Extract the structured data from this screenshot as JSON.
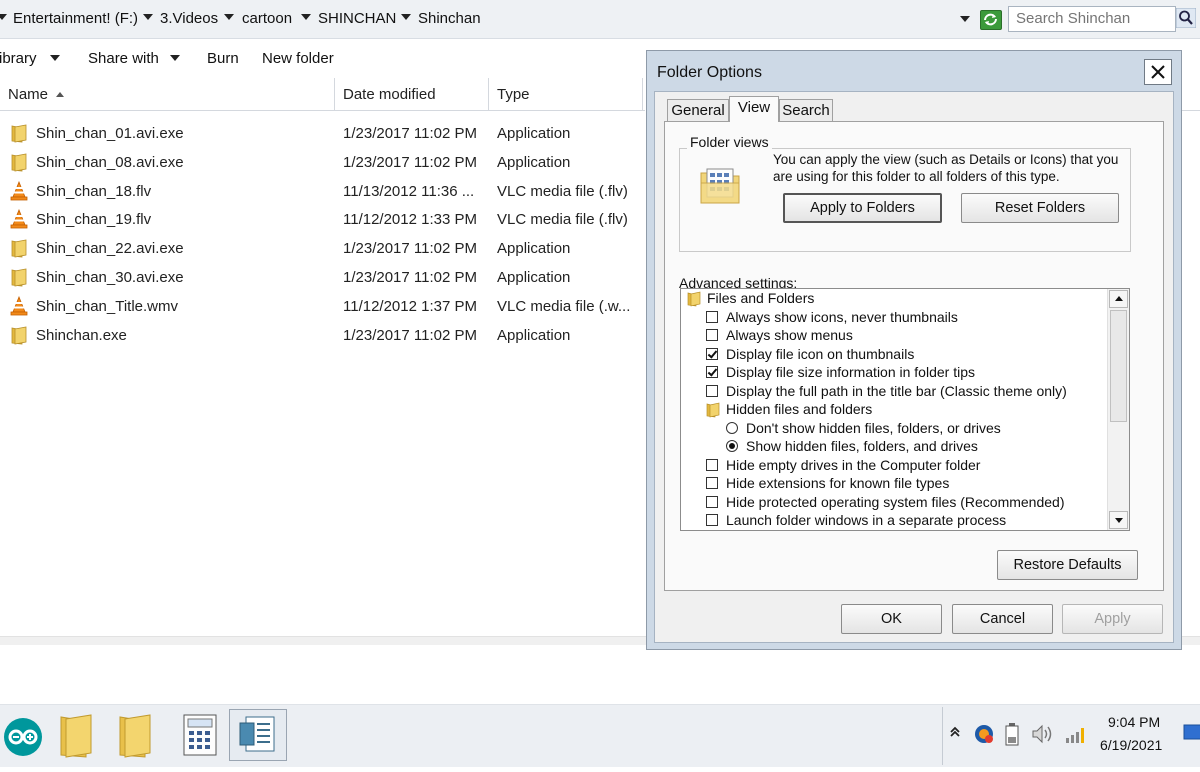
{
  "address_bar": {
    "crumbs": [
      "Entertainment! (F:)",
      "3.Videos",
      "cartoon",
      "SHINCHAN",
      "Shinchan"
    ],
    "search_placeholder": "Search Shinchan"
  },
  "toolbar": {
    "library": "ibrary",
    "share_with": "Share with",
    "burn": "Burn",
    "new_folder": "New folder"
  },
  "file_list": {
    "columns": [
      "Name",
      "Date modified",
      "Type"
    ],
    "rows": [
      {
        "name": "Shin_chan_01.avi.exe",
        "date": "1/23/2017 11:02 PM",
        "type": "Application",
        "icon": "folder-icon"
      },
      {
        "name": "Shin_chan_08.avi.exe",
        "date": "1/23/2017 11:02 PM",
        "type": "Application",
        "icon": "folder-icon"
      },
      {
        "name": "Shin_chan_18.flv",
        "date": "11/13/2012 11:36 ...",
        "type": "VLC media file (.flv)",
        "icon": "vlc-cone-icon"
      },
      {
        "name": "Shin_chan_19.flv",
        "date": "11/12/2012 1:33 PM",
        "type": "VLC media file (.flv)",
        "icon": "vlc-cone-icon"
      },
      {
        "name": "Shin_chan_22.avi.exe",
        "date": "1/23/2017 11:02 PM",
        "type": "Application",
        "icon": "folder-icon"
      },
      {
        "name": "Shin_chan_30.avi.exe",
        "date": "1/23/2017 11:02 PM",
        "type": "Application",
        "icon": "folder-icon"
      },
      {
        "name": "Shin_chan_Title.wmv",
        "date": "11/12/2012 1:37 PM",
        "type": "VLC media file (.w...",
        "icon": "vlc-cone-icon"
      },
      {
        "name": "Shinchan.exe",
        "date": "1/23/2017 11:02 PM",
        "type": "Application",
        "icon": "folder-icon"
      }
    ]
  },
  "dialog": {
    "title": "Folder Options",
    "tabs": [
      "General",
      "View",
      "Search"
    ],
    "active_tab": "View",
    "folder_views_legend": "Folder views",
    "folder_views_text": "You can apply the view (such as Details or Icons) that you are using for this folder to all folders of this type.",
    "apply_to_folders": "Apply to Folders",
    "reset_folders": "Reset Folders",
    "advanced_label": "Advanced settings:",
    "advanced_items": [
      {
        "label": "Files and Folders",
        "kind": "folder"
      },
      {
        "label": "Always show icons, never thumbnails",
        "kind": "checkbox",
        "checked": false
      },
      {
        "label": "Always show menus",
        "kind": "checkbox",
        "checked": false
      },
      {
        "label": "Display file icon on thumbnails",
        "kind": "checkbox",
        "checked": true
      },
      {
        "label": "Display file size information in folder tips",
        "kind": "checkbox",
        "checked": true
      },
      {
        "label": "Display the full path in the title bar (Classic theme only)",
        "kind": "checkbox",
        "checked": false
      },
      {
        "label": "Hidden files and folders",
        "kind": "folder"
      },
      {
        "label": "Don't show hidden files, folders, or drives",
        "kind": "radio",
        "checked": false
      },
      {
        "label": "Show hidden files, folders, and drives",
        "kind": "radio",
        "checked": true
      },
      {
        "label": "Hide empty drives in the Computer folder",
        "kind": "checkbox",
        "checked": false
      },
      {
        "label": "Hide extensions for known file types",
        "kind": "checkbox",
        "checked": false
      },
      {
        "label": "Hide protected operating system files (Recommended)",
        "kind": "checkbox",
        "checked": false
      },
      {
        "label": "Launch folder windows in a separate process",
        "kind": "checkbox",
        "checked": false
      }
    ],
    "restore_defaults": "Restore Defaults",
    "ok": "OK",
    "cancel": "Cancel",
    "apply": "Apply"
  },
  "taskbar": {
    "apps": [
      "arduino-icon",
      "folder-icon",
      "folder-icon",
      "calculator-icon",
      "document-viewer-icon"
    ],
    "time": "9:04 PM",
    "date": "6/19/2021"
  },
  "colors": {
    "dialog_frame": "#cdd9e6",
    "folder_yellow": "#e8c04a",
    "vlc_orange": "#f28a1a"
  }
}
